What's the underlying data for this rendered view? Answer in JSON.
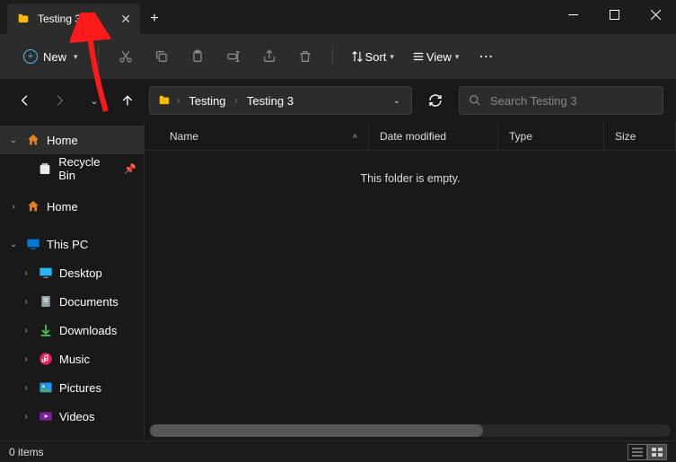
{
  "tab": {
    "title": "Testing 3"
  },
  "toolbar": {
    "new_label": "New",
    "sort_label": "Sort",
    "view_label": "View"
  },
  "breadcrumb": [
    "Testing",
    "Testing 3"
  ],
  "search": {
    "placeholder": "Search Testing 3"
  },
  "columns": {
    "name": "Name",
    "date": "Date modified",
    "type": "Type",
    "size": "Size"
  },
  "empty_message": "This folder is empty.",
  "sidebar": {
    "home": "Home",
    "recycle": "Recycle Bin",
    "home2": "Home",
    "thispc": "This PC",
    "desktop": "Desktop",
    "documents": "Documents",
    "downloads": "Downloads",
    "music": "Music",
    "pictures": "Pictures",
    "videos": "Videos"
  },
  "status": {
    "items": "0 items"
  }
}
